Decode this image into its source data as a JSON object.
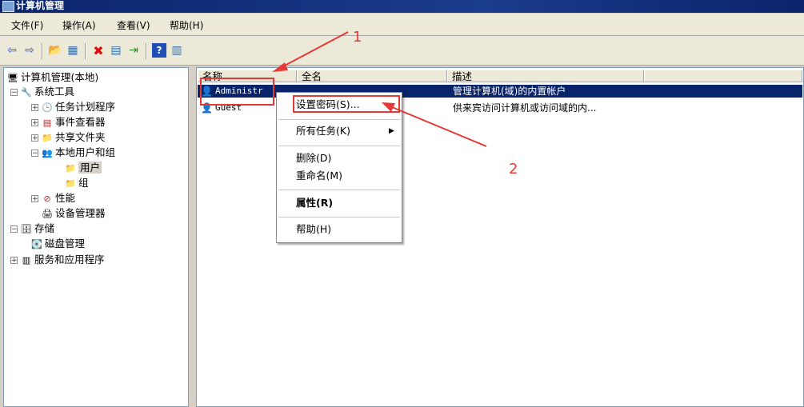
{
  "window": {
    "title": "计算机管理"
  },
  "menubar": [
    "文件(F)",
    "操作(A)",
    "查看(V)",
    "帮助(H)"
  ],
  "toolbar": [
    {
      "name": "back-icon",
      "glyph": "⇦"
    },
    {
      "name": "forward-icon",
      "glyph": "⇨"
    },
    {
      "name": "up-folder-icon",
      "glyph": "📂"
    },
    {
      "name": "show-hide-tree-icon",
      "glyph": "▦"
    },
    {
      "name": "delete-icon",
      "glyph": "✖"
    },
    {
      "name": "properties-icon",
      "glyph": "▤"
    },
    {
      "name": "export-icon",
      "glyph": "⇥"
    },
    {
      "name": "help-icon",
      "glyph": "?"
    },
    {
      "name": "show-action-pane-icon",
      "glyph": "▥"
    }
  ],
  "tree": [
    {
      "label": "计算机管理(本地)",
      "indent": 0,
      "exp": "",
      "icon": "computer-icon",
      "glyph": "🖥"
    },
    {
      "label": "系统工具",
      "indent": 1,
      "exp": "−",
      "icon": "tools-icon",
      "glyph": "🔧"
    },
    {
      "label": "任务计划程序",
      "indent": 2,
      "exp": "+",
      "icon": "clock-icon",
      "glyph": "🕒"
    },
    {
      "label": "事件查看器",
      "indent": 2,
      "exp": "+",
      "icon": "event-viewer-icon",
      "glyph": "▤"
    },
    {
      "label": "共享文件夹",
      "indent": 2,
      "exp": "+",
      "icon": "shared-folder-icon",
      "glyph": "📁"
    },
    {
      "label": "本地用户和组",
      "indent": 2,
      "exp": "−",
      "icon": "users-icon",
      "glyph": "👥"
    },
    {
      "label": "用户",
      "indent": 3,
      "exp": "",
      "icon": "folder-icon",
      "glyph": "📁",
      "selected": true
    },
    {
      "label": "组",
      "indent": 3,
      "exp": "",
      "icon": "folder-icon",
      "glyph": "📁"
    },
    {
      "label": "性能",
      "indent": 2,
      "exp": "+",
      "icon": "performance-icon",
      "glyph": "⊘"
    },
    {
      "label": "设备管理器",
      "indent": 2,
      "exp": "",
      "icon": "device-manager-icon",
      "glyph": "🖨"
    },
    {
      "label": "存储",
      "indent": 1,
      "exp": "−",
      "icon": "storage-icon",
      "glyph": "🗄"
    },
    {
      "label": "磁盘管理",
      "indent": 2,
      "exp": "",
      "icon": "disk-icon",
      "glyph": "💽"
    },
    {
      "label": "服务和应用程序",
      "indent": 1,
      "exp": "+",
      "icon": "services-icon",
      "glyph": "▥"
    }
  ],
  "columns": [
    "名称",
    "全名",
    "描述"
  ],
  "rows": [
    {
      "name": "Administr",
      "fullname": "",
      "desc": "管理计算机(域)的内置帐户"
    },
    {
      "name": "Guest",
      "fullname": "",
      "desc": "供来宾访问计算机或访问域的内..."
    }
  ],
  "context_menu": {
    "set_password": "设置密码(S)...",
    "all_tasks": "所有任务(K)",
    "delete": "删除(D)",
    "rename": "重命名(M)",
    "properties": "属性(R)",
    "help": "帮助(H)"
  },
  "annotations": {
    "one": "1",
    "two": "2",
    "color": "#e53935"
  }
}
